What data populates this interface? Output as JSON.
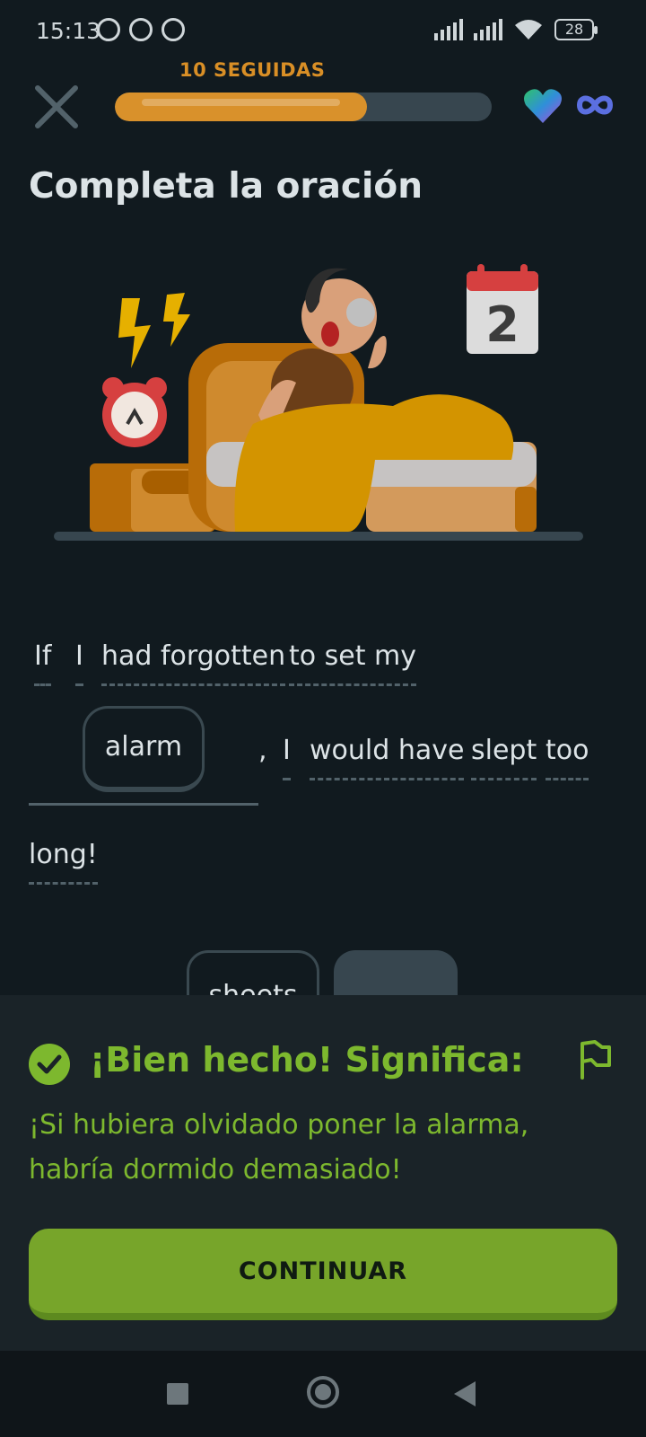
{
  "status_bar": {
    "time": "15:13",
    "battery": "28"
  },
  "lesson": {
    "streak_label": "10 SEGUIDAS",
    "progress_fraction": 0.67,
    "title": "Completa la oración"
  },
  "illustration": {
    "calendar_day": "2"
  },
  "sentence": {
    "line1": [
      "If",
      "I",
      "had forgotten",
      "to set my"
    ],
    "chosen_word": "alarm",
    "comma": ",",
    "line2": [
      "I",
      "would have",
      "slept",
      "too"
    ],
    "line3": "long!"
  },
  "word_bank": {
    "visible_chip": "sheets"
  },
  "feedback": {
    "heading": "¡Bien hecho! Significa:",
    "meaning": "¡Si hubiera olvidado poner la alarma, habría dormido demasiado!",
    "continue_label": "CONTINUAR"
  },
  "colors": {
    "background": "#111a1f",
    "progress_fill": "#d9912b",
    "success_green": "#7db82e",
    "button_green": "#77a52a"
  },
  "icons": [
    "close-icon",
    "heart-icon",
    "infinity-icon",
    "check-circle-icon",
    "flag-icon",
    "alarm-clock-icon",
    "calendar-icon"
  ]
}
